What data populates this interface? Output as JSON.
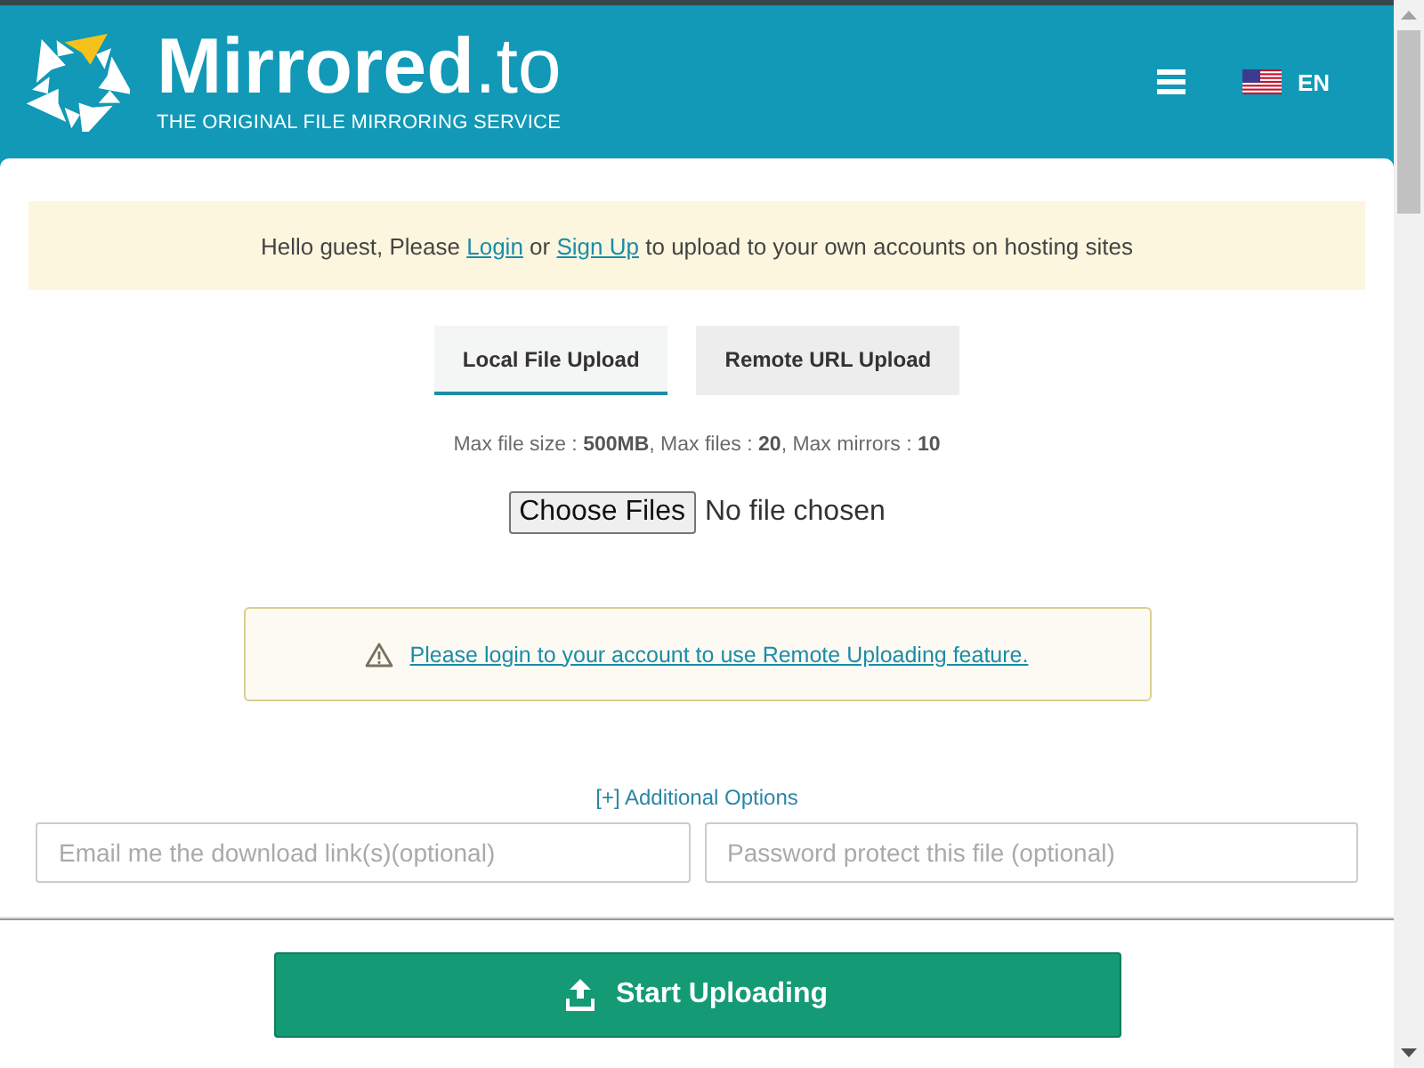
{
  "header": {
    "logo_text": "**Mirrored**.to",
    "tagline": "THE ORIGINAL FILE MIRRORING SERVICE",
    "language": "EN"
  },
  "notice": {
    "segments": [
      {
        "kind": "text",
        "text": "Hello guest, Please"
      },
      {
        "kind": "link",
        "text": "Login"
      },
      {
        "kind": "text",
        "text": "or"
      },
      {
        "kind": "link",
        "text": "Sign Up"
      },
      {
        "kind": "text",
        "text": "to upload to your own accounts on hosting sites"
      }
    ]
  },
  "tabs": [
    {
      "label": "Local File Upload",
      "selected": true
    },
    {
      "label": "Remote URL Upload",
      "selected": false
    }
  ],
  "limits": "Max file size : **500MB**, Max files : **20**, Max mirrors : **10**",
  "file_picker": {
    "button": "Choose Files",
    "status": "No file chosen"
  },
  "remote_warning": {
    "link": "Please login to your account to use Remote Uploading feature."
  },
  "additional_options": "[+] Additional Options",
  "fields": [
    {
      "placeholder": "Email me the download link(s)(optional)"
    },
    {
      "placeholder": "Password protect this file (optional)"
    }
  ],
  "start_button": "Start Uploading"
}
